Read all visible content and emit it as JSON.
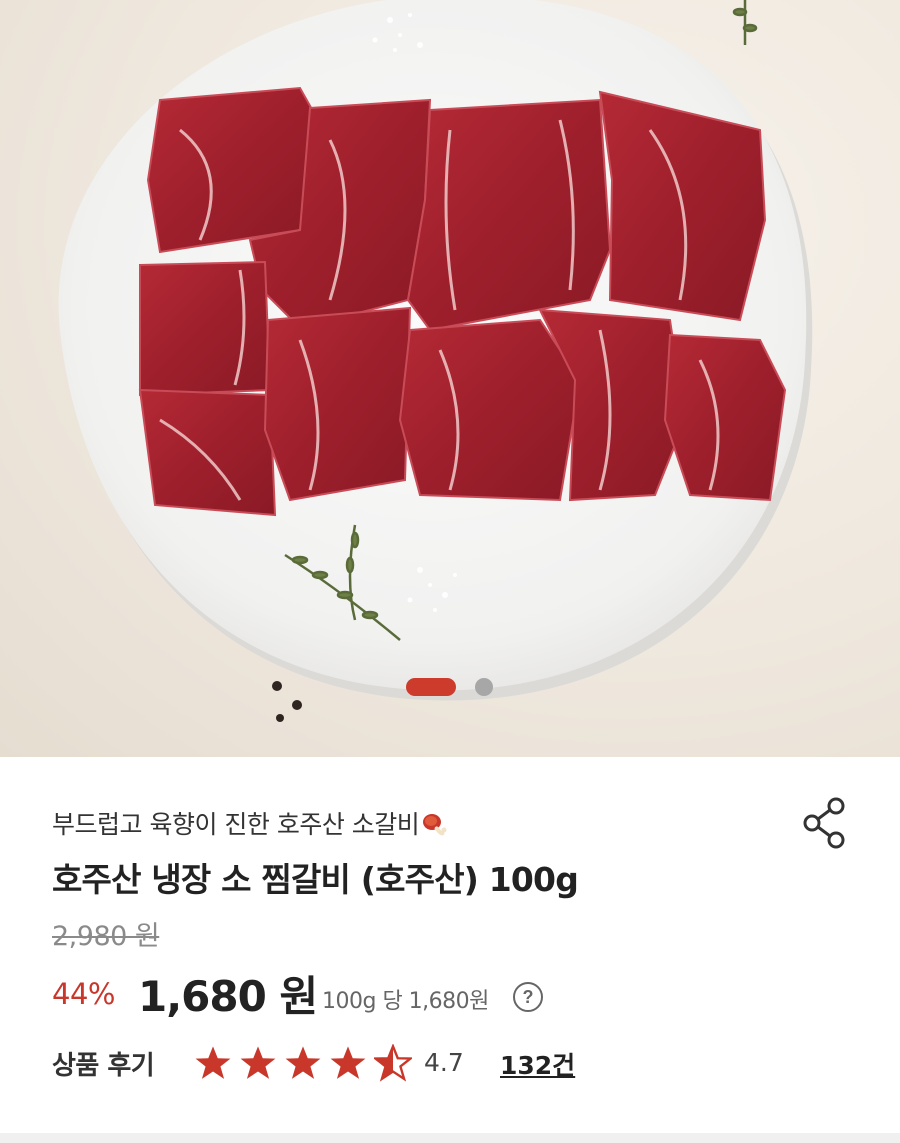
{
  "hero": {
    "image_name": "beef-short-ribs-plate",
    "carousel": {
      "current": 1,
      "total": 2
    },
    "accent": "#cc3b2c"
  },
  "product": {
    "subtitle": "부드럽고 육향이 진한 호주산 소갈비",
    "subtitle_icon": "meat-on-bone-icon",
    "title": "호주산 냉장 소 찜갈비 (호주산) 100g",
    "original_price": "2,980 원",
    "discount": "44%",
    "price": "1,680 원",
    "unit_price": "100g 당 1,680원",
    "help_symbol": "?",
    "share_icon": "share-icon"
  },
  "reviews": {
    "label": "상품 후기",
    "rating": "4.7",
    "rating_value": 4.7,
    "rating_max": 5,
    "count": "132건",
    "star_color": "#c8372a"
  }
}
